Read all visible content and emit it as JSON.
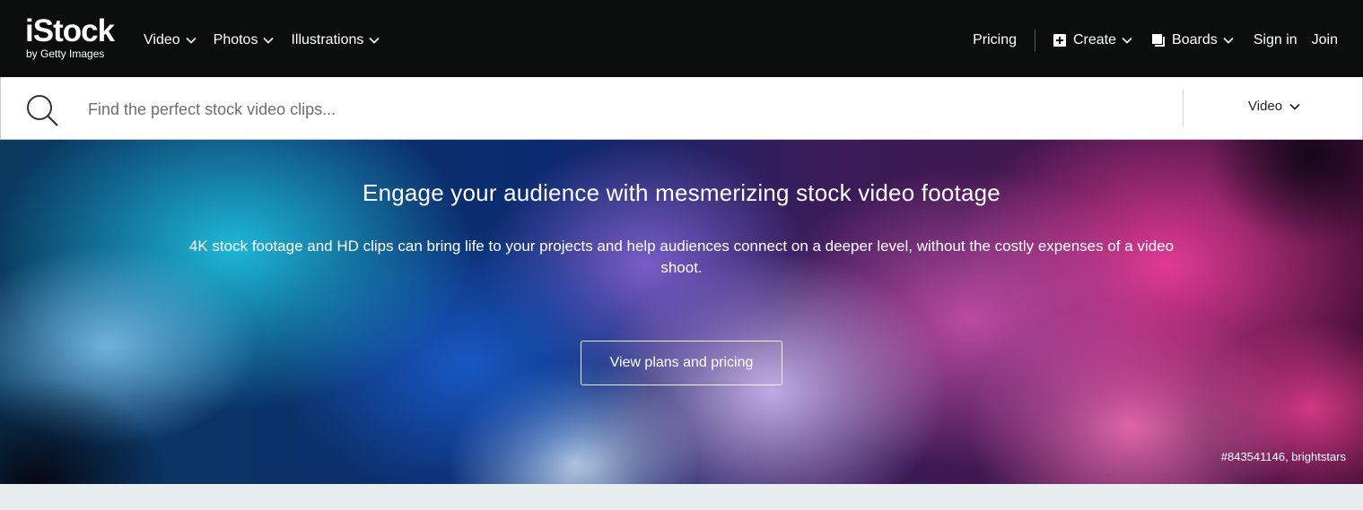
{
  "brand": {
    "name": "iStock",
    "tagline": "by Getty Images"
  },
  "nav": {
    "left": [
      {
        "label": "Video"
      },
      {
        "label": "Photos"
      },
      {
        "label": "Illustrations"
      }
    ],
    "pricing": "Pricing",
    "create": "Create",
    "boards": "Boards",
    "sign_in": "Sign in",
    "join": "Join"
  },
  "search": {
    "placeholder": "Find the perfect stock video clips...",
    "value": "",
    "media_type": "Video"
  },
  "hero": {
    "title": "Engage your audience with mesmerizing stock video footage",
    "subtitle": "4K stock footage and HD clips can bring life to your projects and help audiences connect on a deeper level, without the costly expenses of a video shoot.",
    "cta": "View plans and pricing",
    "credit": "#843541146, brightstars"
  },
  "icons": {
    "search": "search-icon",
    "create": "plus-square-icon",
    "boards": "boards-icon",
    "chevron": "chevron-down-icon"
  },
  "colors": {
    "topbar": "#0c0d0d",
    "page_bg": "#e8eeed"
  }
}
